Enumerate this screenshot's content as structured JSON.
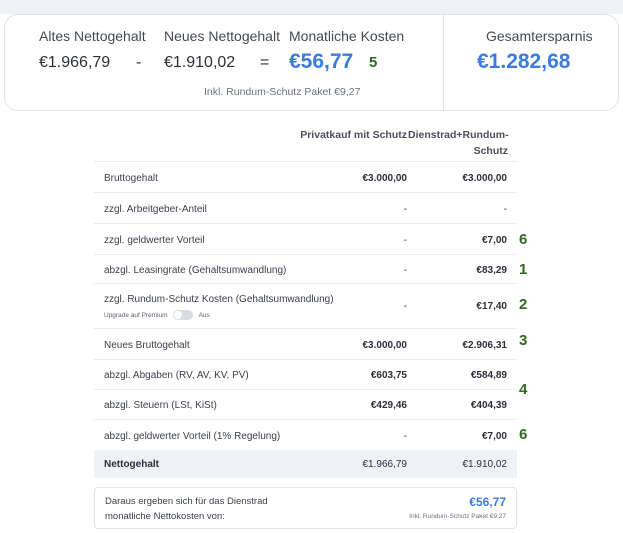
{
  "summary": {
    "old_label": "Altes Nettogehalt",
    "old_value": "€1.966,79",
    "minus": "-",
    "new_label": "Neues Nettogehalt",
    "new_value": "€1.910,02",
    "equals": "=",
    "cost_label": "Monatliche Kosten",
    "cost_value": "€56,77",
    "cost_marker": "5",
    "note": "Inkl. Rundum-Schutz Paket €9,27",
    "savings_label": "Gesamtersparnis",
    "savings_value": "€1.282,68"
  },
  "table": {
    "col1_header": "Privatkauf mit Schutz",
    "col2_header": "Dienstrad+Rundum-Schutz",
    "rows": [
      {
        "label": "Bruttogehalt",
        "v1": "€3.000,00",
        "v2": "€3.000,00",
        "marker": ""
      },
      {
        "label": "zzgl. Arbeitgeber-Anteil",
        "v1": "-",
        "v2": "-",
        "marker": ""
      },
      {
        "label": "zzgl. geldwerter Vorteil",
        "v1": "-",
        "v2": "€7,00",
        "marker": "6"
      },
      {
        "label": "abzgl. Leasingrate (Gehaltsumwandlung)",
        "v1": "-",
        "v2": "€83,29",
        "marker": "1"
      },
      {
        "label": "zzgl. Rundum-Schutz Kosten (Gehaltsumwandlung)",
        "v1": "-",
        "v2": "€17,40",
        "marker": "2"
      },
      {
        "label": "Neues Bruttogehalt",
        "v1": "€3.000,00",
        "v2": "€2.906,31",
        "marker": "3"
      },
      {
        "label": "abzgl. Abgaben (RV, AV, KV, PV)",
        "v1": "€603,75",
        "v2": "€584,89",
        "marker": ""
      },
      {
        "label": "abzgl. Steuern (LSt, KiSt)",
        "v1": "€429,46",
        "v2": "€404,39",
        "marker": ""
      },
      {
        "label": "abzgl. geldwerter Vorteil (1% Regelung)",
        "v1": "-",
        "v2": "€7,00",
        "marker": "6"
      }
    ],
    "taxes_marker": "4",
    "upgrade_label": "Upgrade auf Premium",
    "upgrade_state": "Aus",
    "net_label": "Nettogehalt",
    "net_v1": "€1.966,79",
    "net_v2": "€1.910,02"
  },
  "result": {
    "line1": "Daraus ergeben sich für das Dienstrad",
    "line2": "monatliche Nettokosten von:",
    "amount": "€56,77",
    "note": "Inkl. Rundum-Schutz Paket €9,27"
  }
}
